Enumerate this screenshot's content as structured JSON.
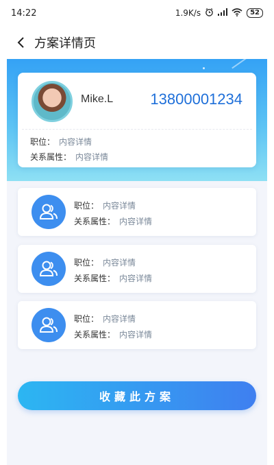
{
  "status_bar": {
    "time": "14:22",
    "speed": "1.9K/s",
    "battery": "52"
  },
  "nav": {
    "title": "方案详情页"
  },
  "profile": {
    "name": "Mike.L",
    "phone": "13800001234",
    "position_label": "职位：",
    "position_value": "内容详情",
    "relation_label": "关系属性：",
    "relation_value": "内容详情"
  },
  "members": [
    {
      "position_label": "职位：",
      "position_value": "内容详情",
      "relation_label": "关系属性：",
      "relation_value": "内容详情"
    },
    {
      "position_label": "职位：",
      "position_value": "内容详情",
      "relation_label": "关系属性：",
      "relation_value": "内容详情"
    },
    {
      "position_label": "职位：",
      "position_value": "内容详情",
      "relation_label": "关系属性：",
      "relation_value": "内容详情"
    }
  ],
  "action": {
    "favorite_label": "收藏此方案"
  },
  "colors": {
    "accent": "#1e6fd9",
    "avatar_bg": "#3d8eef"
  },
  "icons": {
    "back": "chevron-left-icon",
    "member": "users-icon"
  }
}
